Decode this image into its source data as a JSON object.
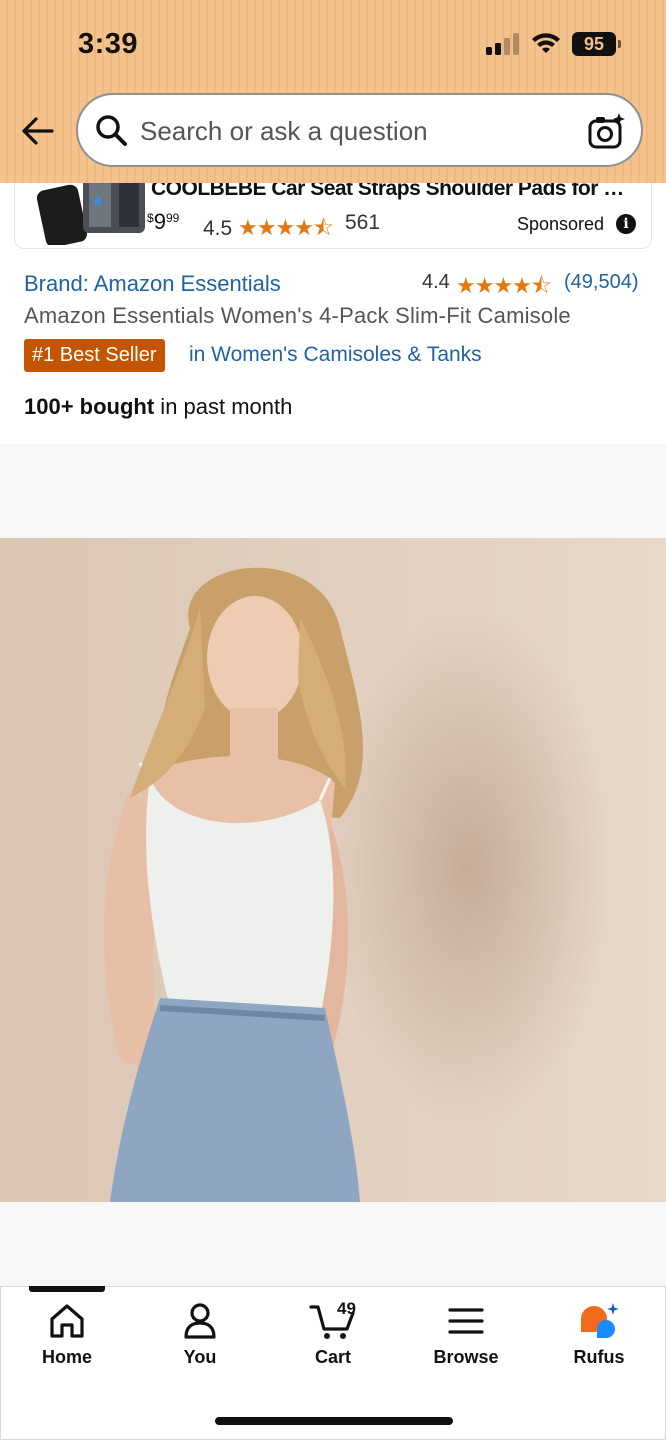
{
  "status_bar": {
    "time": "3:39",
    "battery": "95"
  },
  "search": {
    "placeholder": "Search or ask a question"
  },
  "sponsored_ad": {
    "title": "COOLBEBE Car Seat Straps Shoulder Pads for Bab...",
    "price_dollars": "9",
    "price_cents": "99",
    "price_symbol": "$",
    "rating": "4.5",
    "stars": "★★★★⯪",
    "review_count": "561",
    "label": "Sponsored"
  },
  "product": {
    "brand": "Brand: Amazon Essentials",
    "rating": "4.4",
    "stars": "★★★★⯪",
    "review_count": "(49,504)",
    "title": "Amazon Essentials Women's 4-Pack Slim-Fit Camisole",
    "badge": "#1 Best Seller",
    "category": "in Women's Camisoles & Tanks",
    "bought_bold": "100+ bought",
    "bought_rest": " in past month"
  },
  "tabbar": {
    "items": [
      {
        "label": "Home",
        "icon": "home-icon"
      },
      {
        "label": "You",
        "icon": "person-icon"
      },
      {
        "label": "Cart",
        "icon": "cart-icon"
      },
      {
        "label": "Browse",
        "icon": "menu-icon"
      },
      {
        "label": "Rufus",
        "icon": "rufus-icon"
      }
    ],
    "cart_count": "49",
    "active": "Home"
  },
  "colors": {
    "header": "#f4c28c",
    "link": "#2162a1",
    "badge": "#c45500",
    "star": "#e47911"
  }
}
